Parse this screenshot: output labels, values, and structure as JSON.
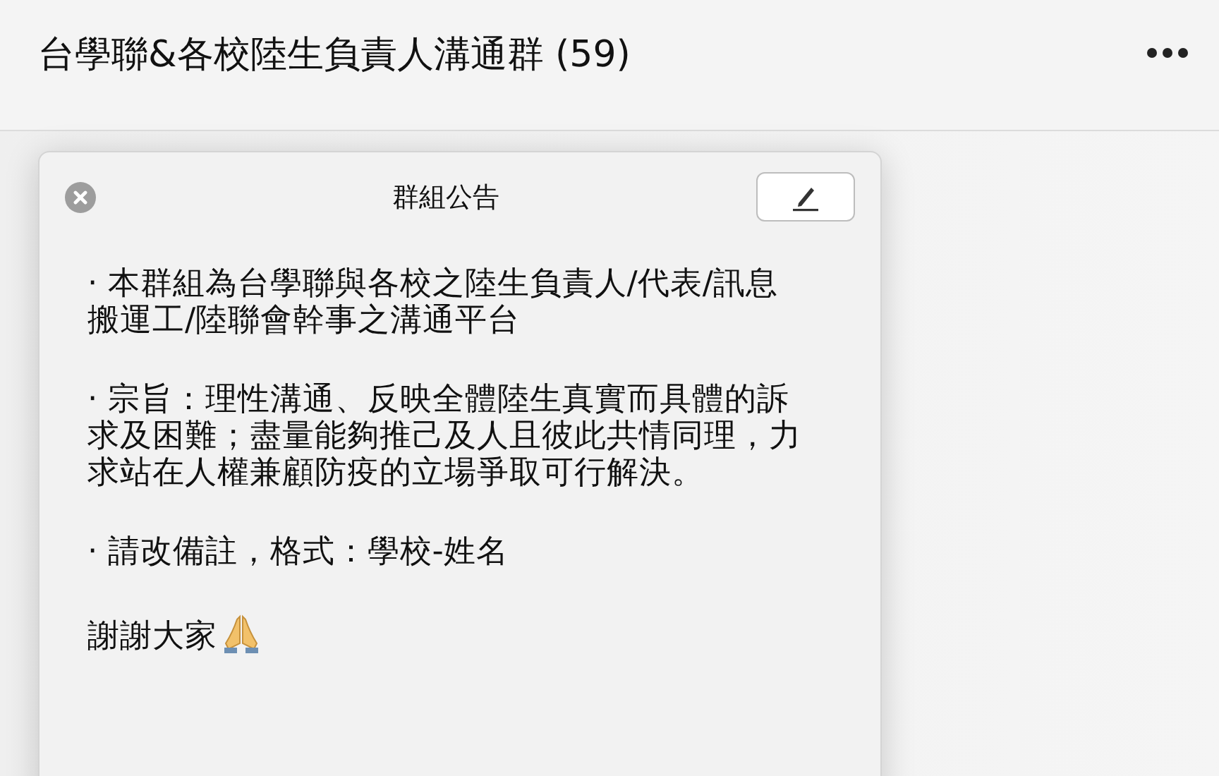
{
  "header": {
    "title": "台學聯&各校陸生負責人溝通群 (59)"
  },
  "announcement": {
    "title": "群組公告",
    "paragraphs": [
      {
        "kind": "text",
        "text": "· 本群組為台學聯與各校之陸生負責人/代表/訊息搬運工/陸聯會幹事之溝通平台"
      },
      {
        "kind": "text",
        "text": "· 宗旨：理性溝通、反映全體陸生真實而具體的訴求及困難；盡量能夠推己及人且彼此共情同理，力求站在人權兼顧防疫的立場爭取可行解決。"
      },
      {
        "kind": "text",
        "text": "· 請改備註，格式：學校-姓名"
      },
      {
        "kind": "thanks",
        "text": "謝謝大家"
      }
    ]
  }
}
